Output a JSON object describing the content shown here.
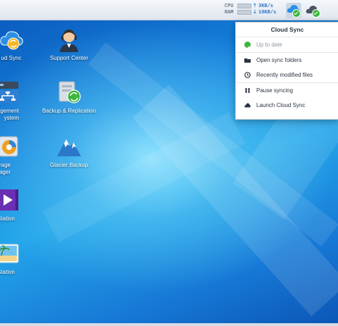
{
  "taskbar": {
    "resource_monitor": {
      "cpu_label": "CPU",
      "ram_label": "RAM",
      "cpu_level": 0.0,
      "ram_level": 0.0,
      "upload": "3KB/s",
      "download": "10KB/s",
      "upload_arrow": "⇡",
      "download_arrow": "⇣"
    },
    "tray_icons": [
      "cloud-sync-icon",
      "cloud-check-icon"
    ]
  },
  "desktop": {
    "icons": [
      {
        "label": "ud Sync",
        "icon": "cloud-sync-icon"
      },
      {
        "label": "Support Center",
        "icon": "support-agent-icon"
      },
      {
        "label": "Management\nystem",
        "icon": "management-system-icon"
      },
      {
        "label": "Backup & Replication",
        "icon": "backup-replication-icon"
      },
      {
        "label": "torage\nanager",
        "icon": "storage-manager-icon"
      },
      {
        "label": "Glacier Backup",
        "icon": "glacier-mountain-icon"
      },
      {
        "label": "o Station",
        "icon": "video-station-icon"
      },
      {
        "label": "o Station",
        "icon": "photo-station-icon"
      }
    ]
  },
  "menu": {
    "title": "Cloud Sync",
    "status": "Up to date",
    "items": [
      {
        "label": "Open sync folders",
        "icon": "folder-icon"
      },
      {
        "label": "Recently modified files",
        "icon": "clock-icon"
      },
      {
        "label": "Pause syncing",
        "icon": "pause-icon"
      },
      {
        "label": "Launch Cloud Sync",
        "icon": "cloud-app-icon"
      }
    ]
  },
  "colors": {
    "desktop_blue": "#1679d4",
    "check_green": "#3cb73c",
    "menu_text": "#2b3440"
  }
}
